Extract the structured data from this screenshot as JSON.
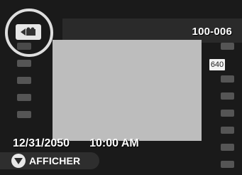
{
  "status": {
    "frame_number": "100-006",
    "image_size": "640",
    "date": "12/31/2050",
    "time": "10:00 AM"
  },
  "mode_icon": "movie-camera-icon",
  "button": {
    "icon": "down-triangle-icon",
    "label": "AFFICHER"
  },
  "colors": {
    "background": "#1a1a1a",
    "preview": "#bdbdbd",
    "sprocket": "#555555",
    "text": "#ffffff"
  }
}
